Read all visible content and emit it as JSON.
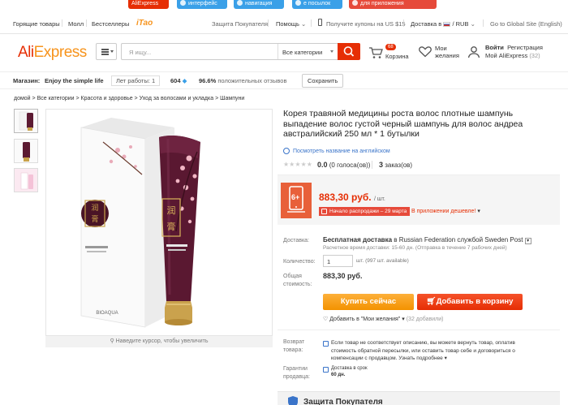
{
  "promo": {
    "pills": [
      {
        "label": "AliExpress",
        "color": "#e62e04"
      },
      {
        "label": "интерфейс",
        "color": "#3aa0e8"
      },
      {
        "label": "навигация",
        "color": "#3aa0e8"
      },
      {
        "label": "е посылок",
        "color": "#3aa0e8"
      },
      {
        "label": "для приложения",
        "color": "#e64a3a"
      }
    ]
  },
  "topnav": {
    "hot": "Горящие товары",
    "mall": "Молл",
    "bestsellers": "Бестселлеры",
    "tao": "iTao",
    "protection": "Защита Покупателя",
    "help": "Помощь",
    "coupons": "Получите купоны на US $15",
    "delivery": "Доставка в",
    "currency": "/ RUB",
    "global": "Go to Global Site (English)"
  },
  "header": {
    "logo_ali": "Ali",
    "logo_express": "Express",
    "search_placeholder": "Я ищу...",
    "categories": "Все категории",
    "cart_count": "68",
    "cart_label": "Корзина",
    "wish_line1": "Мои",
    "wish_line2": "желания",
    "signin": "Войти",
    "register": "Регистрация",
    "myali": "Мой AliExpress",
    "myali_count": "(32)"
  },
  "store": {
    "label": "Магазин:",
    "name": "Enjoy the simple life",
    "years": "Лет работы: 1",
    "score": "604",
    "positive_pct": "96.6%",
    "positive_label": "положительных отзывов",
    "save": "Сохранить"
  },
  "breadcrumb": "домой > Все категории > Красота и здоровье > Уход за волосами и укладка > Шампуни",
  "gallery": {
    "zoom_hint": "Наведите курсор, чтобы увеличить",
    "brand": "BIOAQUA"
  },
  "product": {
    "title": "Корея травяной медицины роста волос плотные шампунь выпадение волос густой черный шампунь для волос андреа австралийский 250 мл * 1 бутылки",
    "translate": "Посмотреть название на английском",
    "rating_value": "0.0",
    "votes": "(0 голоса(ов))",
    "orders_count": "3",
    "orders_label": "заказ(ов)",
    "price": "883,30 руб.",
    "price_unit": "/ шт.",
    "sale_start": "Начало распродажи – 29 марта",
    "app_deal": "В приложении дешевле!",
    "badge_num": "6+"
  },
  "shipping": {
    "label": "Доставка:",
    "free": "Бесплатная доставка",
    "to": "в",
    "country": "Russian Federation",
    "service": "службой Sweden Post",
    "time": "Расчетное время доставки: 15-60 дн. (Отправка в течение 7 рабочих дней)"
  },
  "quantity": {
    "label": "Количество:",
    "value": "1",
    "note": "шт. (997 шт. available)"
  },
  "total": {
    "label_1": "Общая",
    "label_2": "стоимость:",
    "value": "883,30 руб."
  },
  "actions": {
    "buy_now": "Купить сейчас",
    "add_cart": "Добавить в корзину",
    "wishlist": "Добавить в \"Мои желания\"",
    "wishlist_count": "(32 добавили)"
  },
  "returns": {
    "label_1": "Возврат",
    "label_2": "товара:",
    "text": "Если товар не соответствует описанию, вы можете вернуть товар, оплатив стоимость обратной пересылки, или оставить товар себе и договориться о компенсации с продавцом.",
    "more": "Узнать подробнее"
  },
  "guarantee": {
    "label_1": "Гарантии",
    "label_2": "продавца:",
    "line1": "Доставка в срок",
    "line2": "60 дн."
  },
  "protection_title": "Защита Покупателя",
  "colors": {
    "accent": "#e62e04",
    "buy": "#f39200",
    "link": "#3a74c9"
  }
}
